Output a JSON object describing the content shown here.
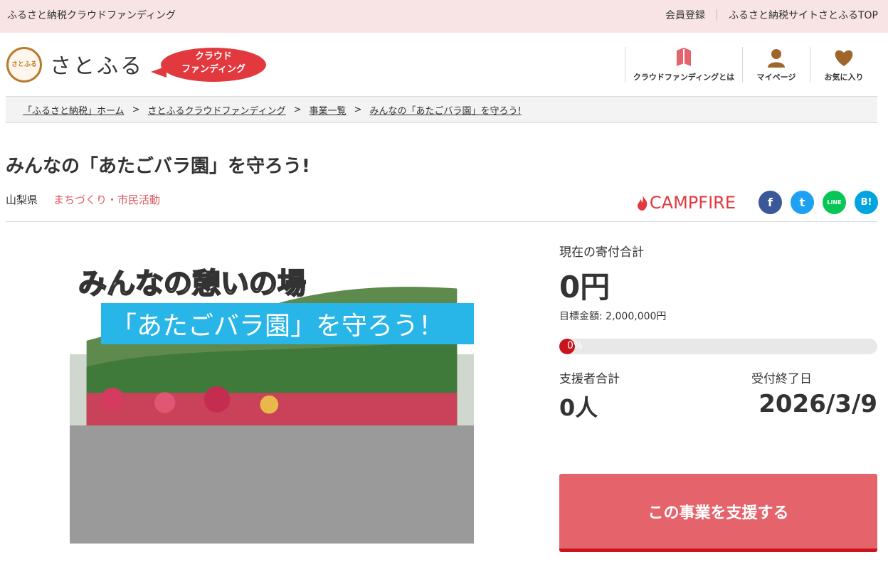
{
  "topbar": {
    "site_name": "ふるさと納税クラウドファンディング",
    "member_register": "会員登録",
    "satofull_top": "ふるさと納税サイトさとふるTOP"
  },
  "header": {
    "logo_mark": "さとふる",
    "logo_text": "さとふる",
    "badge_line1": "クラウド",
    "badge_line2": "ファンディング",
    "nav": {
      "about": "クラウドファンディングとは",
      "mypage": "マイページ",
      "favorites": "お気に入り"
    }
  },
  "breadcrumb": [
    "「ふるさと納税」ホーム",
    "さとふるクラウドファンディング",
    "事業一覧",
    "みんなの「あたごバラ園」を守ろう!"
  ],
  "breadcrumb_sep": ">",
  "project": {
    "title": "みんなの「あたごバラ園」を守ろう!",
    "prefecture": "山梨県",
    "category": "まちづくり・市民活動",
    "platform": "CAMPFIRE",
    "image_title1": "みんなの憩いの場",
    "image_title2": "「あたごバラ園」を守ろう！"
  },
  "share": {
    "facebook": "f",
    "twitter": "t",
    "line": "LINE",
    "hatena": "B!"
  },
  "stats": {
    "current_label": "現在の寄付合計",
    "current_amount": "0円",
    "goal_text": "目標金額: 2,000,000円",
    "progress_text": "0%",
    "progress_fraction": 0,
    "supporters_label": "支援者合計",
    "supporters_value": "0人",
    "end_label": "受付終了日",
    "end_value": "2026/3/9"
  },
  "cta_label": "この事業を支援する",
  "colors": {
    "topbar_bg": "#f8e4e4",
    "brand_red": "#e2393f",
    "cta_bg": "#e5636a",
    "progress_fill": "#c8141c",
    "category_text": "#e05a60"
  }
}
